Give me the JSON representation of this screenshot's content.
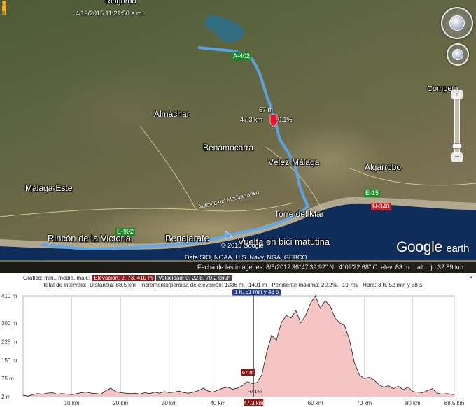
{
  "map": {
    "timestamp": "4/19/2015  11:21:50 a.m.",
    "top_place": "Riogordo",
    "places": [
      {
        "name": "Almáchar"
      },
      {
        "name": "Benamocarra"
      },
      {
        "name": "Vélez-Málaga"
      },
      {
        "name": "Algarrobo"
      },
      {
        "name": "Málaga-Este"
      },
      {
        "name": "Torre del Mar"
      },
      {
        "name": "Rincón de la Victoria"
      },
      {
        "name": "Benajarafe"
      },
      {
        "name": "Cómpeta"
      }
    ],
    "route_label": "Vuelta en bici matutina",
    "road_tags": {
      "a402": "A-402",
      "e15a": "E-15",
      "n340": "N-340",
      "e902": "E-902",
      "autovia": "Autovía del Mediterráneo"
    },
    "track_readout": {
      "elevation": "57 m",
      "distance": "47.3 km",
      "grade": "-0.1%"
    },
    "copyright": "© 2015 Google",
    "data_sources": "Data SIO, NOAA, U.S. Navy, NGA, GEBCO",
    "logo_main": "Google",
    "logo_sub": "earth",
    "status": {
      "imagery_date": "Fecha de las imágenes: 8/5/2012",
      "lat": "36°47'39.92\" N",
      "lon": "4°09'22.68\" O",
      "elev": "elev.   83 m",
      "eye_alt": "alt. ojo   32.89 km"
    },
    "colors": {
      "track": "#5aa9f0",
      "sea": "#0e2d5a",
      "pin": "#e8102a"
    }
  },
  "profile": {
    "summary_row1": {
      "label": "Gráfico: mín., media, máx.:",
      "elevation": "Elevación: 2, 73, 410 m",
      "speed": "Velocidad: 0, 22.8, 70.2 km/h"
    },
    "summary_row2": {
      "label": "Total de intervalo:",
      "distance": "Distancia: 88.5 km",
      "gain_loss": "Incremento/pérdida de elevación: 1386 m, -1401 m",
      "max_grade": "Pendiente máxima: 20.2%, -19.7%",
      "time": "Hora: 3 h, 52 min y 38 s"
    },
    "marker_time": "1 h, 51 min y 43 s",
    "marker_elev": "57 m",
    "marker_grade": "-0.1%",
    "marker_km": "47.3 km",
    "close_icon": "×"
  },
  "chart_data": {
    "type": "area",
    "xlabel": "",
    "ylabel": "",
    "x_ticks": [
      "10 km",
      "20 km",
      "30 km",
      "40 km",
      "47.3 km",
      "60 km",
      "70 km",
      "80 km",
      "88.5 km"
    ],
    "y_ticks": [
      "410 m",
      "300 m",
      "225 m",
      "150 m",
      "75 m",
      "2 m"
    ],
    "ylim": [
      2,
      410
    ],
    "xlim": [
      0,
      88.5
    ],
    "marker_x": 47.3,
    "series": [
      {
        "x": [
          0,
          1,
          2,
          3,
          4,
          5,
          6,
          7,
          8,
          9,
          10,
          11,
          12,
          13,
          14,
          15,
          16,
          17,
          18,
          19,
          20,
          21,
          22,
          23,
          24,
          25,
          26,
          27,
          28,
          29,
          30,
          31,
          32,
          33,
          34,
          35,
          36,
          37,
          38,
          39,
          40,
          41,
          42,
          43,
          44,
          45,
          46,
          47,
          48,
          49,
          50,
          51,
          52,
          53,
          54,
          55,
          56,
          57,
          58,
          59,
          60,
          61,
          62,
          63,
          64,
          65,
          66,
          67,
          68,
          69,
          70,
          71,
          72,
          73,
          74,
          75,
          76,
          77,
          78,
          79,
          80,
          81,
          82,
          83,
          84,
          85,
          86,
          87,
          88.5
        ],
        "y": [
          8,
          4,
          10,
          14,
          12,
          16,
          18,
          12,
          14,
          12,
          10,
          14,
          18,
          20,
          16,
          14,
          12,
          26,
          36,
          22,
          18,
          16,
          14,
          16,
          12,
          18,
          14,
          20,
          16,
          22,
          18,
          20,
          24,
          18,
          16,
          20,
          26,
          36,
          24,
          20,
          28,
          36,
          40,
          32,
          36,
          46,
          62,
          55,
          58,
          90,
          180,
          250,
          230,
          300,
          330,
          320,
          350,
          300,
          330,
          380,
          410,
          360,
          390,
          370,
          320,
          300,
          290,
          230,
          140,
          90,
          75,
          80,
          70,
          50,
          40,
          46,
          34,
          44,
          30,
          40,
          22,
          20,
          18,
          26,
          34,
          16,
          12,
          14,
          10
        ]
      }
    ]
  }
}
